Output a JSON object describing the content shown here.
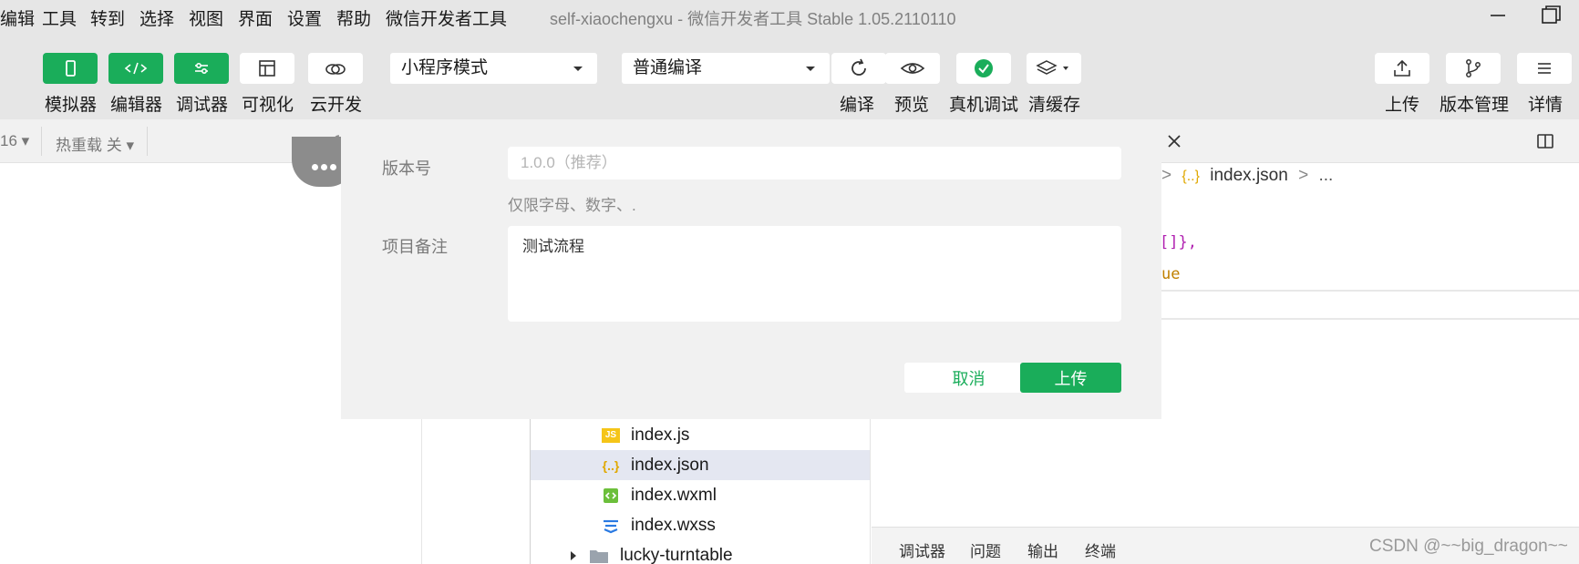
{
  "menubar": {
    "items": [
      "编辑",
      "工具",
      "转到",
      "选择",
      "视图",
      "界面",
      "设置",
      "帮助",
      "微信开发者工具"
    ],
    "window_title": "self-xiaochengxu - 微信开发者工具 Stable 1.05.2110110"
  },
  "toolbar": {
    "left_buttons": [
      {
        "label": "模拟器",
        "icon": "phone-icon"
      },
      {
        "label": "编辑器",
        "icon": "code-icon"
      },
      {
        "label": "调试器",
        "icon": "sliders-icon"
      },
      {
        "label": "可视化",
        "icon": "layout-icon"
      },
      {
        "label": "云开发",
        "icon": "cloud-icon"
      }
    ],
    "mode_select": "小程序模式",
    "compile_select": "普通编译",
    "mid_buttons": [
      {
        "label": "编译",
        "icon": "refresh-icon"
      },
      {
        "label": "预览",
        "icon": "eye-icon"
      },
      {
        "label": "真机调试",
        "icon": "check-circle-icon"
      },
      {
        "label": "清缓存",
        "icon": "layers-icon"
      }
    ],
    "right_buttons": [
      {
        "label": "上传",
        "icon": "upload-icon"
      },
      {
        "label": "版本管理",
        "icon": "branch-icon"
      },
      {
        "label": "详情",
        "icon": "menu-icon"
      }
    ]
  },
  "subbar": {
    "zoom_fragment": "16",
    "hot_reload": "热重载 关"
  },
  "editor": {
    "breadcrumb": {
      "separator": ">",
      "file": "index.json",
      "more": "..."
    },
    "code_fragments": {
      "brace": "[]},",
      "keyword": "ue"
    }
  },
  "file_tree": {
    "files": [
      {
        "name": "index.js",
        "icon": "js-file-icon",
        "selected": false
      },
      {
        "name": "index.json",
        "icon": "json-file-icon",
        "selected": true
      },
      {
        "name": "index.wxml",
        "icon": "wxml-file-icon",
        "selected": false
      },
      {
        "name": "index.wxss",
        "icon": "wxss-file-icon",
        "selected": false
      }
    ],
    "folder": "lucky-turntable"
  },
  "bottom_tabs": [
    "调试器",
    "问题",
    "输出",
    "终端"
  ],
  "watermark": "CSDN @~~big_dragon~~",
  "upload_dialog": {
    "version_label": "版本号",
    "version_placeholder": "1.0.0（推荐）",
    "version_hint": "仅限字母、数字、.",
    "note_label": "项目备注",
    "note_value": "测试流程",
    "cancel_label": "取消",
    "upload_label": "上传"
  },
  "colors": {
    "accent": "#1aad5a",
    "toolbar_bg": "#e6e6e6",
    "modal_bg": "#f1f1f1",
    "selected_row": "#e4e7f1"
  }
}
